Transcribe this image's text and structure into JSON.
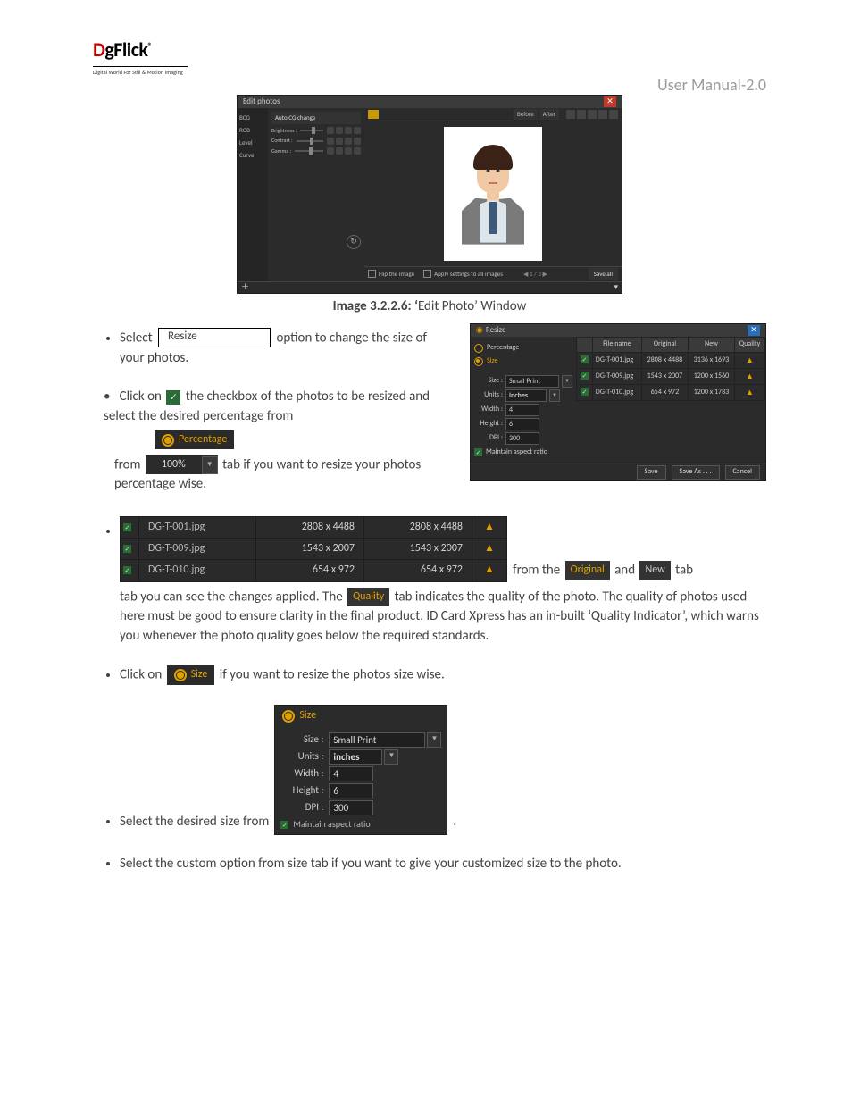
{
  "header": {
    "manual": "User Manual-2.0"
  },
  "logo": {
    "name_html": "DgFlick",
    "reg": "®",
    "tagline": "Digital World For Still & Motion Imaging"
  },
  "editWindow": {
    "title": "Edit photos",
    "sideTabs": [
      "BCG",
      "RGB",
      "Level",
      "Curve"
    ],
    "panelTitle": "Auto CG change",
    "sliders": [
      "Brightness :",
      "Contrast :",
      "Gamma :"
    ],
    "before": "Before",
    "after": "After",
    "flip": "Flip the image",
    "applyAll": "Apply settings to all images",
    "pager": "1 / 3",
    "saveAll": "Save all"
  },
  "caption": {
    "bold": "Image 3.2.2.6: ‘",
    "rest": "Edit Photo’ Window"
  },
  "bullets": {
    "b1a": "Select",
    "b1_chip": "Resize",
    "b1b": "option to change the size of your photos.",
    "b2a": "Click on",
    "b2b": "the checkbox of the photos to be resized and select the desired percentage from",
    "b2_pill": "Percentage",
    "b2_combo": "100%",
    "b2c": "tab if you want to resize your photos percentage wise.",
    "b3_mid1": "from the",
    "b3_orig": "Original",
    "b3_and": "and",
    "b3_new": "New",
    "b3_mid2": "tab you can see the changes applied. The",
    "b3_quality": "Quality",
    "b3_rest": "tab indicates the quality of the photo. The quality of photos used here must be good to ensure clarity in the final product. ID Card Xpress has an in-built ‘Quality Indicator’, which warns you whenever the photo quality goes below the required standards.",
    "b4a": "Click on",
    "b4_pill": "Size",
    "b4b": "if you want to resize the photos size wise.",
    "b5a": "Select the desired size from",
    "b5b": ".",
    "b6": "Select the custom option from size tab if you want to give your customized size to the photo."
  },
  "resizeDlg": {
    "title": "Resize",
    "radioPercentage": "Percentage",
    "radioSize": "Size",
    "fields": {
      "sizeL": "Size :",
      "sizeV": "Small Print",
      "unitsL": "Units :",
      "unitsV": "inches",
      "widthL": "Width :",
      "widthV": "4",
      "heightL": "Height :",
      "heightV": "6",
      "dpiL": "DPI :",
      "dpiV": "300",
      "aspect": "Maintain aspect ratio"
    },
    "headers": [
      "",
      "File name",
      "Original",
      "New",
      "Quality"
    ],
    "rows": [
      {
        "name": "DG-T-001.jpg",
        "orig": "2808 x 4488",
        "new": "3136 x 1693"
      },
      {
        "name": "DG-T-009.jpg",
        "orig": "1543 x 2007",
        "new": "1200 x 1560"
      },
      {
        "name": "DG-T-010.jpg",
        "orig": "654 x 972",
        "new": "1200 x 1783"
      }
    ],
    "save": "Save",
    "saveAs": "Save As . . .",
    "cancel": "Cancel"
  },
  "strip": [
    {
      "name": "DG-T-001.jpg",
      "orig": "2808 x 4488",
      "new": "2808 x 4488"
    },
    {
      "name": "DG-T-009.jpg",
      "orig": "1543 x 2007",
      "new": "1543 x 2007"
    },
    {
      "name": "DG-T-010.jpg",
      "orig": "654 x 972",
      "new": "654 x 972"
    }
  ],
  "sizeBlock": {
    "head": "Size",
    "sizeL": "Size :",
    "sizeV": "Small Print",
    "unitsL": "Units :",
    "unitsV": "inches",
    "widthL": "Width :",
    "widthV": "4",
    "heightL": "Height :",
    "heightV": "6",
    "dpiL": "DPI :",
    "dpiV": "300",
    "aspect": "Maintain aspect ratio"
  }
}
